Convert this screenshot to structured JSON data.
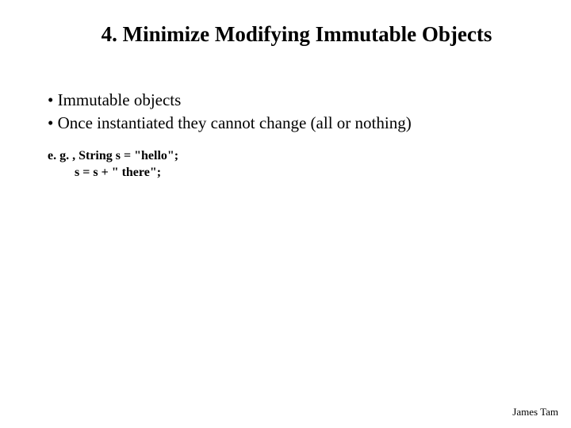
{
  "title": "4. Minimize Modifying Immutable Objects",
  "bullets": [
    "• Immutable objects",
    "• Once instantiated they cannot change (all or nothing)"
  ],
  "example": {
    "line1": "e. g. , String s = \"hello\";",
    "line2": "s = s + \" there\";"
  },
  "footer": "James Tam"
}
